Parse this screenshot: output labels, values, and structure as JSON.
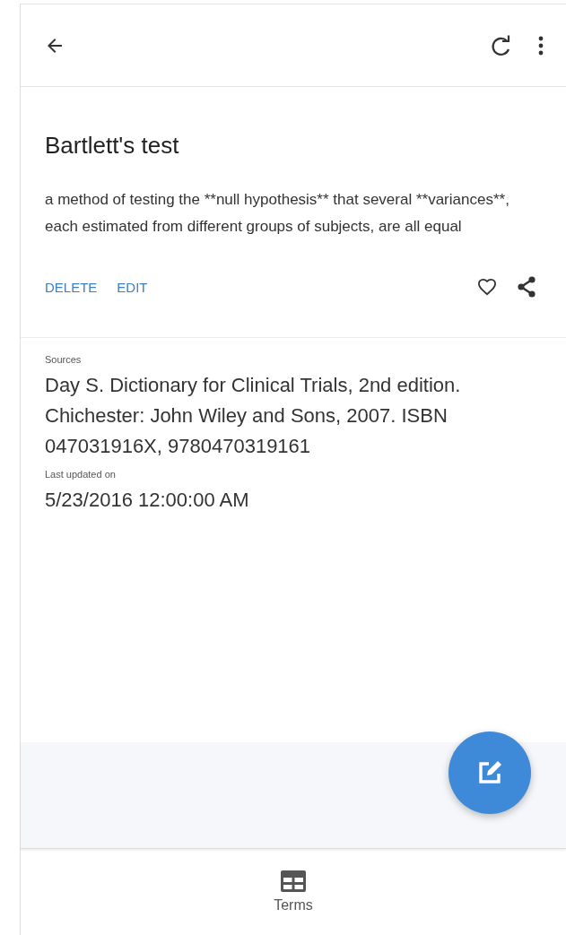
{
  "term": {
    "title": "Bartlett's test",
    "definition": "a method of testing the **null hypothesis** that several **variances**, each estimated from different groups of subjects, are all equal"
  },
  "actions": [
    {
      "label": "DELETE"
    },
    {
      "label": "EDIT"
    }
  ],
  "favorite": {
    "selected": false
  },
  "details": [
    {
      "label": "Sources",
      "value": "Day S.  Dictionary for Clinical Trials, 2nd edition.  Chichester: John Wiley and Sons, 2007.  ISBN 047031916X, 9780470319161"
    },
    {
      "label": "Last updated on",
      "value": "5/23/2016 12:00:00 AM"
    }
  ],
  "bottom_nav": [
    {
      "label": "Terms",
      "selected": true
    }
  ]
}
